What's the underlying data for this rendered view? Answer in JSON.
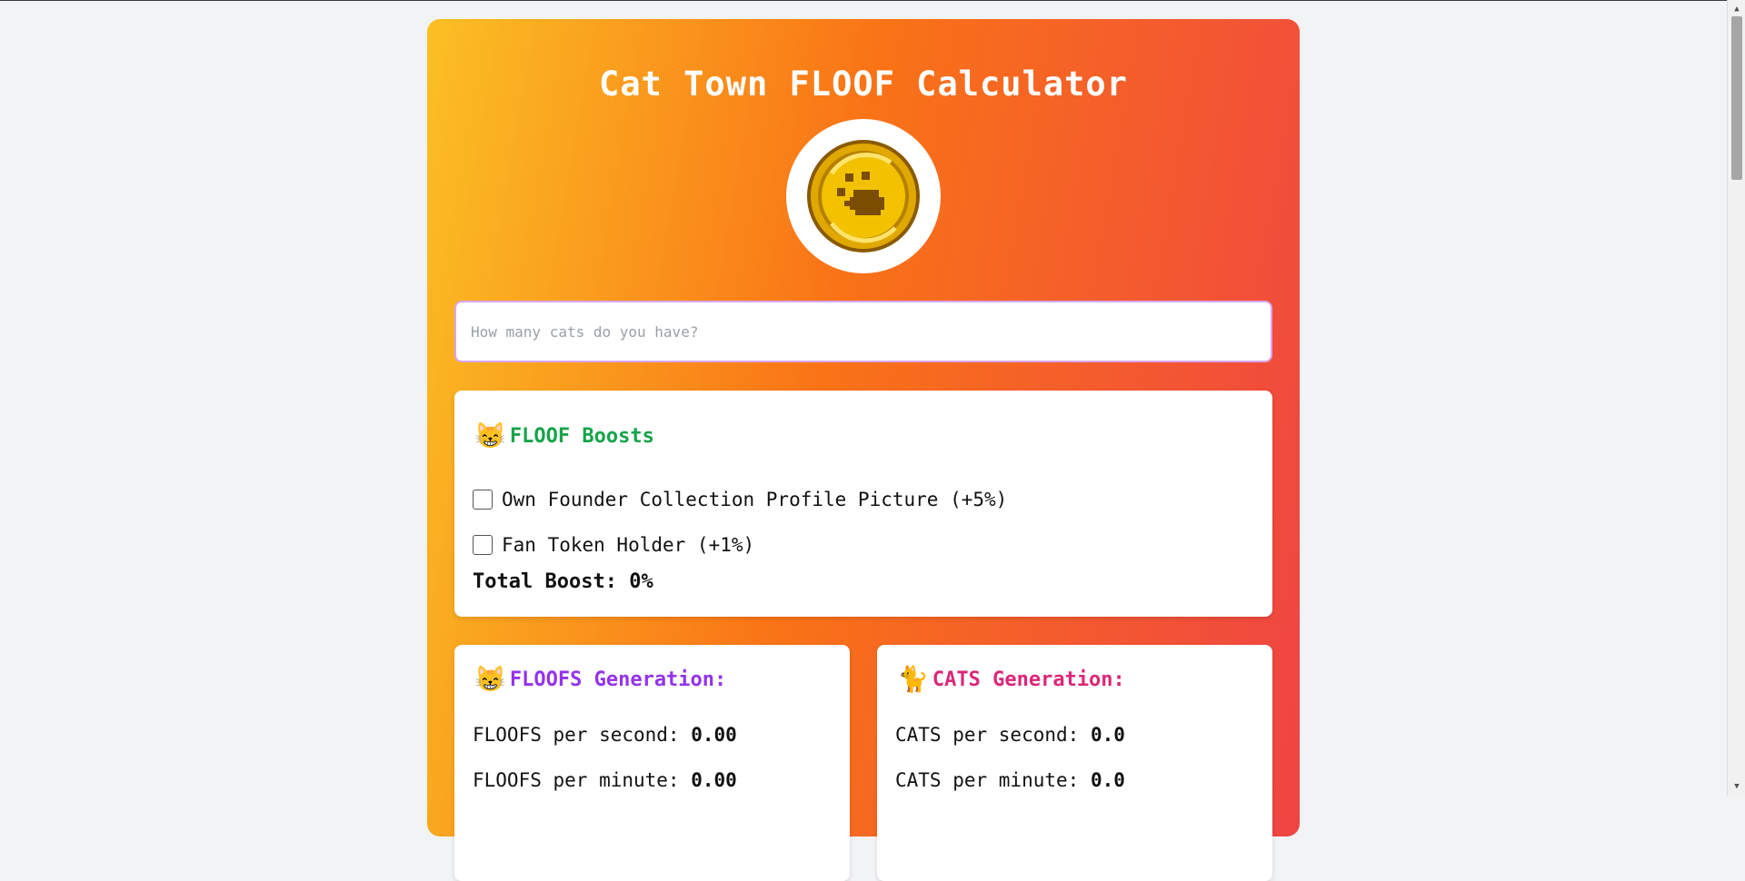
{
  "title": "Cat Town FLOOF Calculator",
  "input": {
    "placeholder": "How many cats do you have?",
    "value": ""
  },
  "boosts": {
    "emoji": "😸",
    "heading": "FLOOF Boosts",
    "options": [
      {
        "label": "Own Founder Collection Profile Picture (+5%)",
        "checked": false
      },
      {
        "label": "Fan Token Holder (+1%)",
        "checked": false
      }
    ],
    "total_label": "Total Boost:",
    "total_value": "0%"
  },
  "floofs_gen": {
    "emoji": "😸",
    "heading": "FLOOFS Generation:",
    "per_second_label": "FLOOFS per second:",
    "per_second": "0.00",
    "per_minute_label": "FLOOFS per minute:",
    "per_minute": "0.00"
  },
  "cats_gen": {
    "emoji": "🐈",
    "heading": "CATS Generation:",
    "per_second_label": "CATS per second:",
    "per_second": "0.0",
    "per_minute_label": "CATS per minute:",
    "per_minute": "0.0"
  },
  "colors": {
    "gradient_start": "#fbbf24",
    "gradient_mid": "#f97316",
    "gradient_end": "#ef4444",
    "boost_heading": "#16a34a",
    "floofs_heading": "#9333ea",
    "cats_heading": "#db2777"
  },
  "icons": {
    "logo": "floof-coin-paw-icon"
  }
}
